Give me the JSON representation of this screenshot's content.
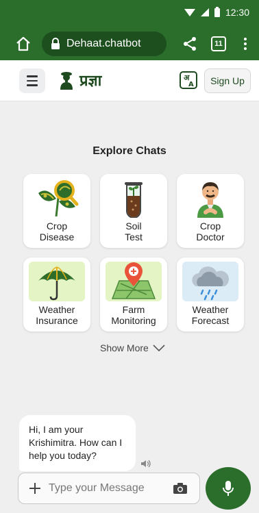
{
  "status_bar": {
    "time": "12:30"
  },
  "browser": {
    "url": "Dehaat.chatbot",
    "tab_count": "11"
  },
  "header": {
    "logo_text": "प्रज्ञा",
    "signup_label": "Sign Up",
    "lang_icon": "translate-icon"
  },
  "explore": {
    "title": "Explore Chats",
    "cards": [
      {
        "label": "Crop\nDisease",
        "icon": "crop-disease-icon"
      },
      {
        "label": "Soil\nTest",
        "icon": "soil-test-icon"
      },
      {
        "label": "Crop\nDoctor",
        "icon": "crop-doctor-icon"
      },
      {
        "label": "Weather\nInsurance",
        "icon": "weather-insurance-icon"
      },
      {
        "label": "Farm\nMonitoring",
        "icon": "farm-monitoring-icon"
      },
      {
        "label": "Weather\nForecast",
        "icon": "weather-forecast-icon"
      }
    ],
    "show_more": "Show More"
  },
  "chat": {
    "bot_message": "Hi, I am your Krishimitra. How can I help you today?"
  },
  "input": {
    "placeholder": "Type your Message"
  },
  "colors": {
    "brand_green": "#2b6e2c",
    "dark_green": "#1d4f1e"
  }
}
